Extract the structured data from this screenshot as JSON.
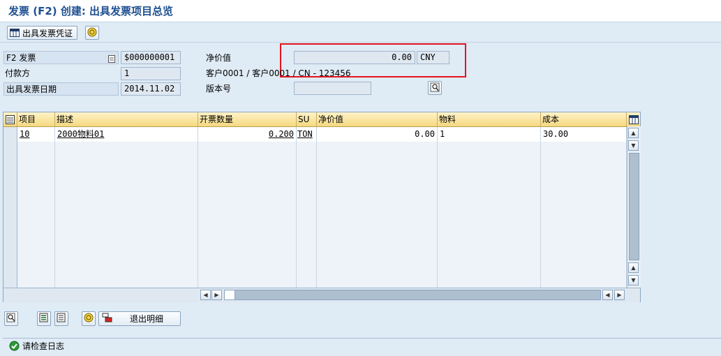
{
  "title": "发票 (F2) 创建: 出具发票项目总览",
  "toolbar": {
    "issue_invoice_doc": "出具发票凭证"
  },
  "header": {
    "doc_type_label": "F2 发票",
    "doc_number": "$000000001",
    "payer_label": "付款方",
    "payer_value": "1",
    "billing_date_label": "出具发票日期",
    "billing_date_value": "2014.11.02",
    "net_value_label": "净价值",
    "net_value": "0.00",
    "currency": "CNY",
    "customer_text": "客户0001 / 客户0001 / CN - 123456",
    "version_label": "版本号",
    "version_value": ""
  },
  "table": {
    "columns": [
      "项目",
      "描述",
      "开票数量",
      "SU",
      "净价值",
      "物料",
      "成本"
    ],
    "rows": [
      {
        "item": "10",
        "desc": "2000物料01",
        "qty": "0.200",
        "su": "TON",
        "net": "0.00",
        "material": "1",
        "cost": "30.00"
      }
    ]
  },
  "bottom": {
    "exit_detail": "退出明细"
  },
  "status": {
    "message": "请检查日志"
  },
  "colors": {
    "title": "#1f5091",
    "highlight": "#e5141d",
    "header_bg": "#f5d980"
  }
}
